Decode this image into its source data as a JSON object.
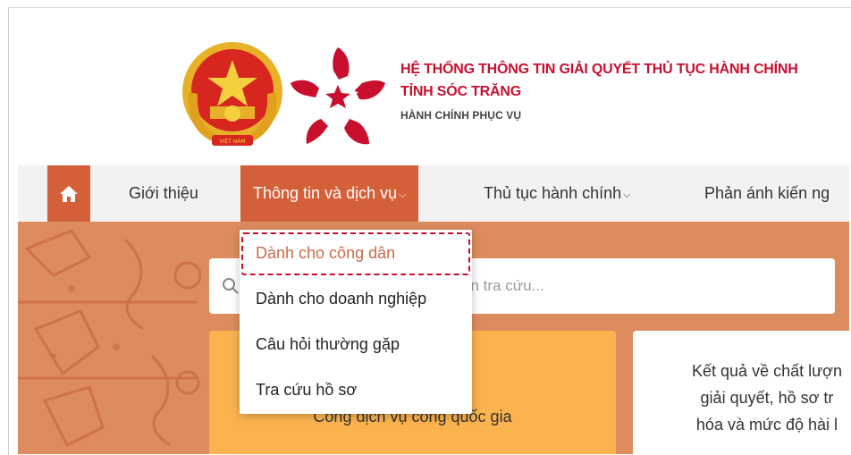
{
  "header": {
    "title_line1": "HỆ THỐNG THÔNG TIN GIẢI QUYẾT THỦ TỤC HÀNH CHÍNH",
    "title_line2": "TỈNH SÓC TRĂNG",
    "subtitle": "HÀNH CHÍNH PHỤC VỤ"
  },
  "nav": {
    "home_icon": "home-icon",
    "items": [
      {
        "label": "Giới thiệu"
      },
      {
        "label": "Thông tin và dịch vụ"
      },
      {
        "label": "Thủ tục hành chính"
      },
      {
        "label": "Phản ánh kiến ng"
      }
    ],
    "active_color": "#d4603a"
  },
  "dropdown": {
    "items": [
      {
        "label": "Dành cho công dân"
      },
      {
        "label": "Dành cho doanh nghiệp"
      },
      {
        "label": "Câu hỏi thường gặp"
      },
      {
        "label": "Tra cứu hồ sơ"
      }
    ]
  },
  "search": {
    "placeholder_visible": "ần tra cứu..."
  },
  "cards": {
    "left_label": "Cổng dịch vụ công quốc gia",
    "right_lines": [
      "Kết quả về chất lượn",
      "giải quyết, hồ sơ tr",
      "hóa và mức độ hài l"
    ]
  },
  "colors": {
    "brand_red": "#c8102e",
    "accent_orange": "#d4603a",
    "banner": "#dd8c5f",
    "card_yellow": "#fbb34f"
  }
}
